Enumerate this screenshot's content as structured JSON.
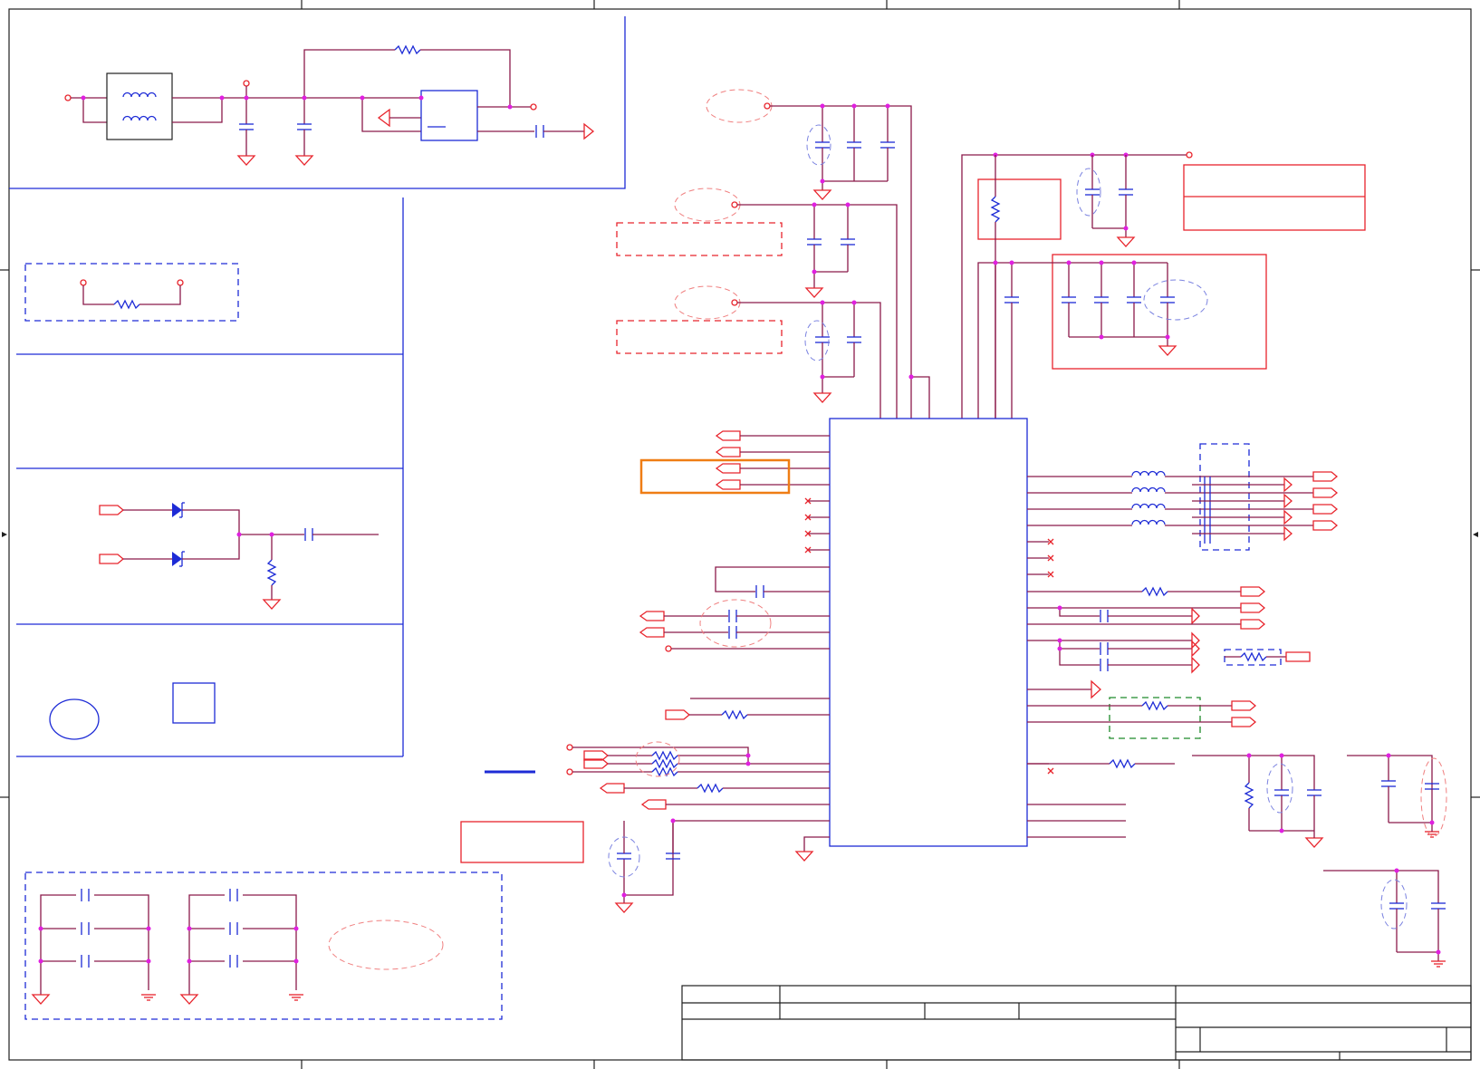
{
  "colors": {
    "wire": "#8b1a4a",
    "symbol": "#e8242c",
    "frame": "#1d2bd6",
    "junction": "#e020e0",
    "highlight": "#ef7d14",
    "group_box": "#1e8a2a"
  }
}
